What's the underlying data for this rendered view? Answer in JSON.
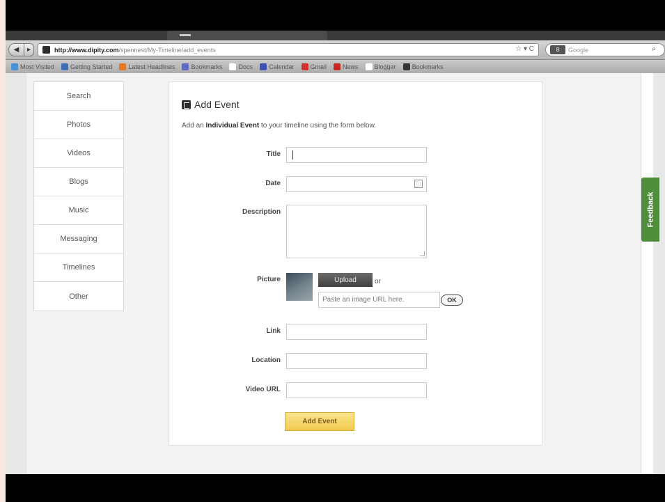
{
  "browser": {
    "url_host": "http://www.dipity.com",
    "url_path": "/spennest/My-Timeline/add_events",
    "url_controls": "☆ ▾ C",
    "search_engine_badge": "8",
    "search_placeholder": "Google",
    "back_glyph": "◀",
    "fwd_glyph": "▸",
    "bookmarks": [
      {
        "label": "Most Visited",
        "icon_color": "#4a90d9"
      },
      {
        "label": "Getting Started",
        "icon_color": "#3b6fb6"
      },
      {
        "label": "Latest Headlines",
        "icon_color": "#e07b2a"
      },
      {
        "label": "Bookmarks",
        "icon_color": "#5c6bc0"
      },
      {
        "label": "Docs",
        "icon_color": "#ffffff"
      },
      {
        "label": "Calendar",
        "icon_color": "#3f51b5"
      },
      {
        "label": "Gmail",
        "icon_color": "#d32f2f"
      },
      {
        "label": "News",
        "icon_color": "#c62828"
      },
      {
        "label": "Blogger",
        "icon_color": "#ffffff"
      },
      {
        "label": "Bookmarks",
        "icon_color": "#333333"
      }
    ]
  },
  "sidebar": {
    "items": [
      {
        "label": "Search"
      },
      {
        "label": "Photos"
      },
      {
        "label": "Videos"
      },
      {
        "label": "Blogs"
      },
      {
        "label": "Music"
      },
      {
        "label": "Messaging"
      },
      {
        "label": "Timelines"
      },
      {
        "label": "Other"
      }
    ]
  },
  "form": {
    "heading": "Add Event",
    "intro_prefix": "Add an ",
    "intro_bold": "Individual Event",
    "intro_suffix": " to your timeline using the form below.",
    "title_label": "Title",
    "date_label": "Date",
    "description_label": "Description",
    "picture_label": "Picture",
    "upload_label": "Upload",
    "or_text": "or",
    "image_url_placeholder": "Paste an image URL here.",
    "ok_label": "OK",
    "link_label": "Link",
    "location_label": "Location",
    "video_url_label": "Video URL",
    "submit_label": "Add Event"
  },
  "feedback_label": "Feedback"
}
